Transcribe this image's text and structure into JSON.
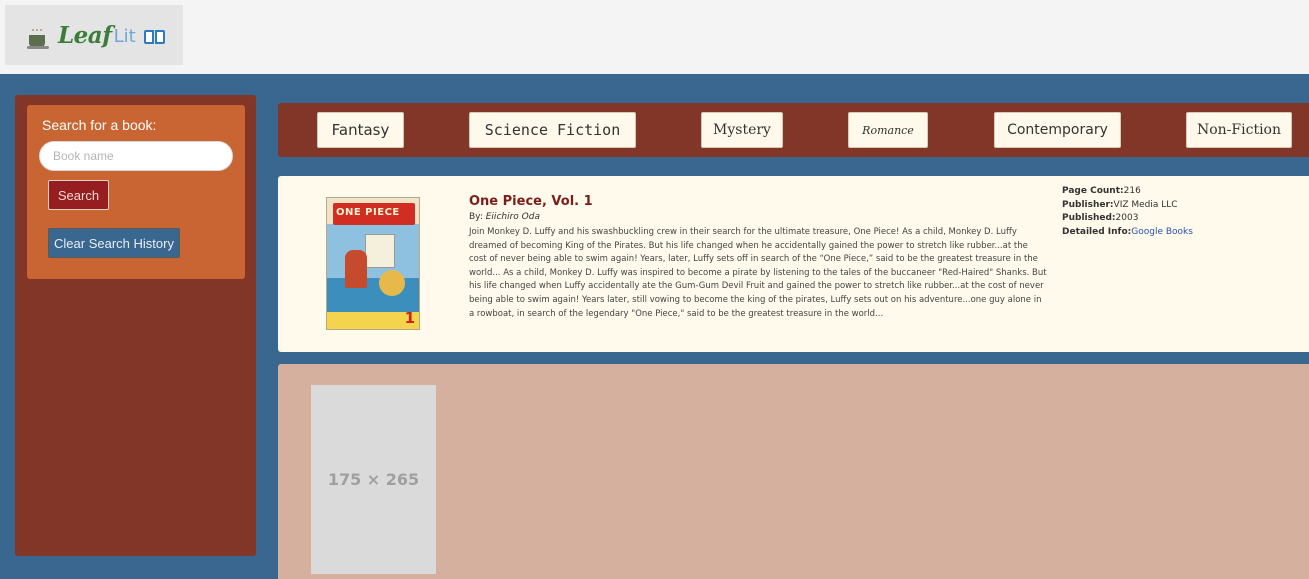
{
  "logo": {
    "leaf": "Leaf",
    "lit": "Lit"
  },
  "search": {
    "label": "Search for a book:",
    "placeholder": "Book name",
    "search_button": "Search",
    "clear_button": "Clear Search History"
  },
  "genres": [
    "Fantasy",
    "Science Fiction",
    "Mystery",
    "Romance",
    "Contemporary",
    "Non-Fiction"
  ],
  "book": {
    "cover_title": "ONE PIECE",
    "cover_badge": "1",
    "title": "One Piece, Vol. 1",
    "by_label": "By: ",
    "author": "Eiichiro Oda",
    "description": "Join Monkey D. Luffy and his swashbuckling crew in their search for the ultimate treasure, One Piece! As a child, Monkey D. Luffy dreamed of becoming King of the Pirates. But his life changed when he accidentally gained the power to stretch like rubber...at the cost of never being able to swim again! Years, later, Luffy sets off in search of the “One Piece,” said to be the greatest treasure in the world... As a child, Monkey D. Luffy was inspired to become a pirate by listening to the tales of the buccaneer \"Red-Haired\" Shanks. But his life changed when Luffy accidentally ate the Gum-Gum Devil Fruit and gained the power to stretch like rubber...at the cost of never being able to swim again! Years later, still vowing to become the king of the pirates, Luffy sets out on his adventure...one guy alone in a rowboat, in search of the legendary \"One Piece,\" said to be the greatest treasure in the world...",
    "page_count_label": "Page Count:",
    "page_count": "216",
    "publisher_label": "Publisher:",
    "publisher": "VIZ Media LLC",
    "published_label": "Published:",
    "published": "2003",
    "detail_label": "Detailed Info:",
    "detail_link": "Google Books"
  },
  "placeholder": {
    "text": "175 × 265"
  },
  "colors": {
    "page_bg": "#3a6790",
    "sidebar": "#823627",
    "search_card": "#c86532",
    "search_button": "#961d20",
    "clear_button": "#3a6790",
    "book_card": "#fffaec",
    "results_bg": "#d6b09f",
    "title": "#7b1e1a",
    "link": "#2356b8"
  }
}
